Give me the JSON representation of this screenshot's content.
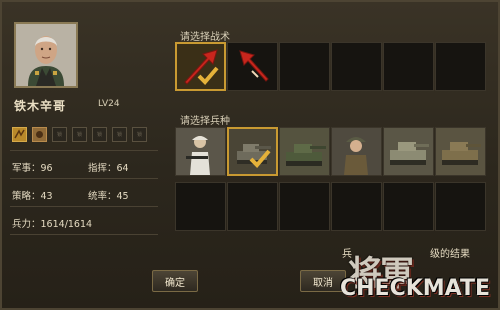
{
  "general": {
    "name": "铁木辛哥",
    "level": "LV24"
  },
  "skills": [
    {
      "label": "",
      "state": "active"
    },
    {
      "label": "",
      "state": "active"
    },
    {
      "label": "",
      "state": "locked"
    },
    {
      "label": "",
      "state": "locked"
    },
    {
      "label": "",
      "state": "locked"
    },
    {
      "label": "",
      "state": "locked"
    },
    {
      "label": "",
      "state": "locked"
    }
  ],
  "stats": {
    "military_label": "军事：",
    "military_value": "96",
    "command_label": "指挥：",
    "command_value": "64",
    "strategy_label": "策略：",
    "strategy_value": "43",
    "leadership_label": "统率：",
    "leadership_value": "45",
    "troops_label": "兵力：",
    "troops_value": "1614/1614"
  },
  "tactics": {
    "title": "请选择战术",
    "slots": [
      {
        "icon": "red-arrow-icon",
        "selected": true
      },
      {
        "icon": "red-arrow-icon",
        "selected": false
      },
      {
        "icon": "",
        "selected": false
      },
      {
        "icon": "",
        "selected": false
      },
      {
        "icon": "",
        "selected": false
      },
      {
        "icon": "",
        "selected": false
      }
    ]
  },
  "units": {
    "title": "请选择兵种",
    "slots": [
      {
        "icon": "infantry-icon",
        "selected": false
      },
      {
        "icon": "artillery-icon",
        "selected": true
      },
      {
        "icon": "tank-icon",
        "selected": false
      },
      {
        "icon": "soldier-icon",
        "selected": false
      },
      {
        "icon": "tank-icon",
        "selected": false
      },
      {
        "icon": "tank-icon",
        "selected": false
      }
    ]
  },
  "hint": {
    "left": "兵",
    "right": "级的结果"
  },
  "buttons": {
    "confirm": "确定",
    "cancel": "取消"
  },
  "logo": {
    "cn": "将軍",
    "en": "CHECKMATE"
  },
  "colors": {
    "gold": "#c99a32",
    "arrow_red": "#c8261d"
  }
}
